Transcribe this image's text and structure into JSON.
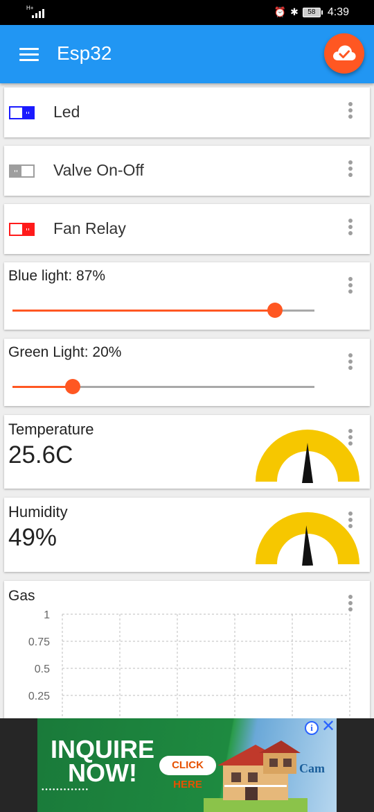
{
  "status_bar": {
    "network": "H+",
    "battery_level": "58",
    "time": "4:39"
  },
  "app_bar": {
    "title": "Esp32",
    "fab_icon": "cloud-done-icon",
    "colors": {
      "bar": "#2196f3",
      "fab": "#ff5722"
    }
  },
  "switches": [
    {
      "label": "Led",
      "state": "on",
      "color": "#1a1aff"
    },
    {
      "label": "Valve On-Off",
      "state": "off",
      "color": "#9e9e9e"
    },
    {
      "label": "Fan Relay",
      "state": "on",
      "color": "#ff1a1a"
    }
  ],
  "sliders": [
    {
      "label": "Blue light: 87%",
      "value": 87
    },
    {
      "label": "Green Light: 20%",
      "value": 20
    }
  ],
  "gauges": [
    {
      "label": "Temperature",
      "value_text": "25.6C",
      "needle_fraction": 0.5,
      "color": "#f6c700"
    },
    {
      "label": "Humidity",
      "value_text": "49%",
      "needle_fraction": 0.49,
      "color": "#f6c700"
    }
  ],
  "chart_data": {
    "type": "line",
    "title": "Gas",
    "y_ticks": [
      "1",
      "0.75",
      "0.5",
      "0.25"
    ],
    "ylim": [
      0,
      1
    ],
    "grid": true,
    "series": []
  },
  "ad": {
    "headline": "INQUIRE NOW!",
    "cta": "CLICK HERE",
    "brand": "Cam",
    "info_icon": "ad-info-icon",
    "close_icon": "ad-close-icon"
  }
}
